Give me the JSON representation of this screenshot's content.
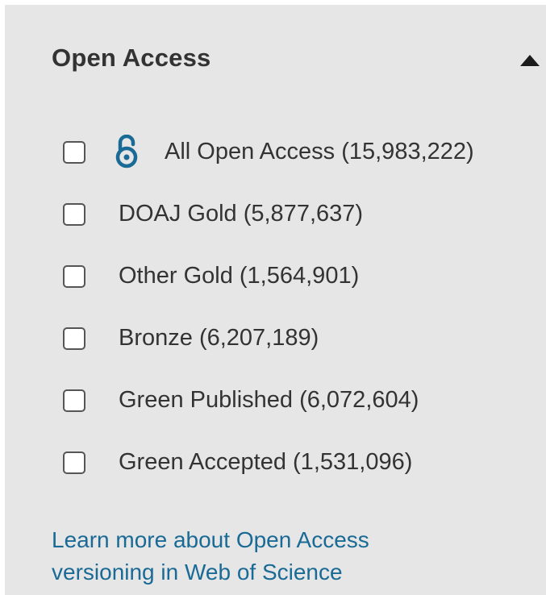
{
  "filter": {
    "title": "Open Access",
    "collapse_icon": "caret-up-icon",
    "accent_color": "#1a6a96",
    "options": [
      {
        "label": "All Open Access (15,983,222)",
        "icon": "open-access-lock-icon",
        "checked": false
      },
      {
        "label": "DOAJ Gold (5,877,637)",
        "checked": false
      },
      {
        "label": "Other Gold (1,564,901)",
        "checked": false
      },
      {
        "label": "Bronze (6,207,189)",
        "checked": false
      },
      {
        "label": "Green Published (6,072,604)",
        "checked": false
      },
      {
        "label": "Green Accepted (1,531,096)",
        "checked": false
      }
    ],
    "learn_more_link": "Learn more about Open Access versioning in Web of Science"
  }
}
